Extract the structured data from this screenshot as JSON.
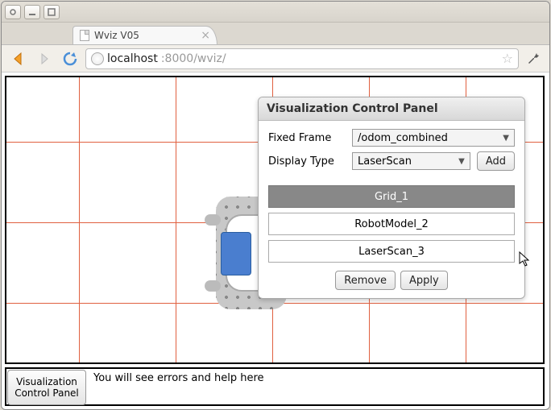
{
  "window": {
    "tab_title": "Wviz V05"
  },
  "address": {
    "host": "localhost",
    "port_path": ":8000/wviz/"
  },
  "panel": {
    "title": "Visualization Control Panel",
    "fixed_frame_label": "Fixed Frame",
    "fixed_frame_value": "/odom_combined",
    "display_type_label": "Display Type",
    "display_type_value": "LaserScan",
    "add_label": "Add",
    "items": [
      "Grid_1",
      "RobotModel_2",
      "LaserScan_3"
    ],
    "remove_label": "Remove",
    "apply_label": "Apply"
  },
  "footer": {
    "button_label": "Visualization Control Panel",
    "help_text": "You will see errors and help here"
  }
}
